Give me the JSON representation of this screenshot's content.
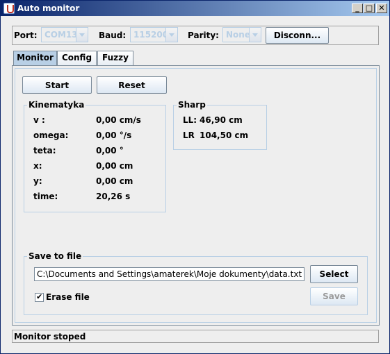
{
  "window": {
    "title": "Auto monitor"
  },
  "connection": {
    "port_label": "Port:",
    "port_value": "COM13",
    "baud_label": "Baud:",
    "baud_value": "115200",
    "parity_label": "Parity:",
    "parity_value": "None",
    "disconnect_label": "Disconn..."
  },
  "tabs": [
    {
      "label": "Monitor"
    },
    {
      "label": "Config"
    },
    {
      "label": "Fuzzy"
    }
  ],
  "monitor": {
    "start_label": "Start",
    "reset_label": "Reset",
    "kinematyka": {
      "title": "Kinematyka",
      "rows": [
        {
          "label": "v :",
          "value": "0,00 cm/s"
        },
        {
          "label": "omega:",
          "value": "0,00 °/s"
        },
        {
          "label": "teta:",
          "value": "0,00 °"
        },
        {
          "label": "x:",
          "value": "0,00 cm"
        },
        {
          "label": "y:",
          "value": "0,00 cm"
        },
        {
          "label": "time:",
          "value": "20,26 s"
        }
      ]
    },
    "sharp": {
      "title": "Sharp",
      "rows": [
        {
          "label": "LL:",
          "value": "46,90 cm"
        },
        {
          "label": "LR",
          "value": "104,50 cm"
        }
      ]
    },
    "save": {
      "title": "Save to file",
      "path": "C:\\Documents and Settings\\amaterek\\Moje dokumenty\\data.txt",
      "select_label": "Select",
      "erase_label": "Erase file",
      "save_label": "Save"
    }
  },
  "status": {
    "text": "Monitor stoped"
  }
}
